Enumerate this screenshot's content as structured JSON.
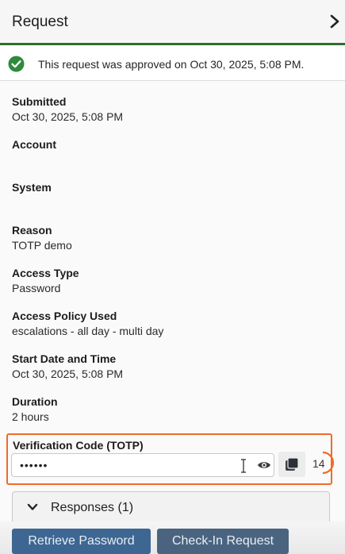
{
  "header": {
    "title": "Request",
    "chevron_icon": "chevron-right-icon"
  },
  "banner": {
    "icon": "check-circle-icon",
    "icon_color": "#2f8a3e",
    "text": "This request was approved on Oct 30, 2025, 5:08 PM."
  },
  "details": [
    {
      "label": "Submitted",
      "value": "Oct 30, 2025, 5:08 PM"
    },
    {
      "label": "Account",
      "value": ""
    },
    {
      "label": "System",
      "value": ""
    },
    {
      "label": "Reason",
      "value": "TOTP demo"
    },
    {
      "label": "Access Type",
      "value": "Password"
    },
    {
      "label": "Access Policy Used",
      "value": "escalations - all day - multi day"
    },
    {
      "label": "Start Date and Time",
      "value": "Oct 30, 2025, 5:08 PM"
    },
    {
      "label": "Duration",
      "value": "2 hours"
    }
  ],
  "totp": {
    "label": "Verification Code (TOTP)",
    "masked_value": "••••••",
    "reveal_icon": "eye-icon",
    "copy_icon": "copy-icon",
    "countdown": "14",
    "highlight_color": "#ef6b2a"
  },
  "responses": {
    "label": "Responses (1)",
    "chevron_icon": "chevron-down-icon"
  },
  "footer": {
    "retrieve_label": "Retrieve Password",
    "checkin_label": "Check-In Request"
  },
  "colors": {
    "accent_green": "#2e6e2e",
    "button_blue": "#3d6792"
  }
}
